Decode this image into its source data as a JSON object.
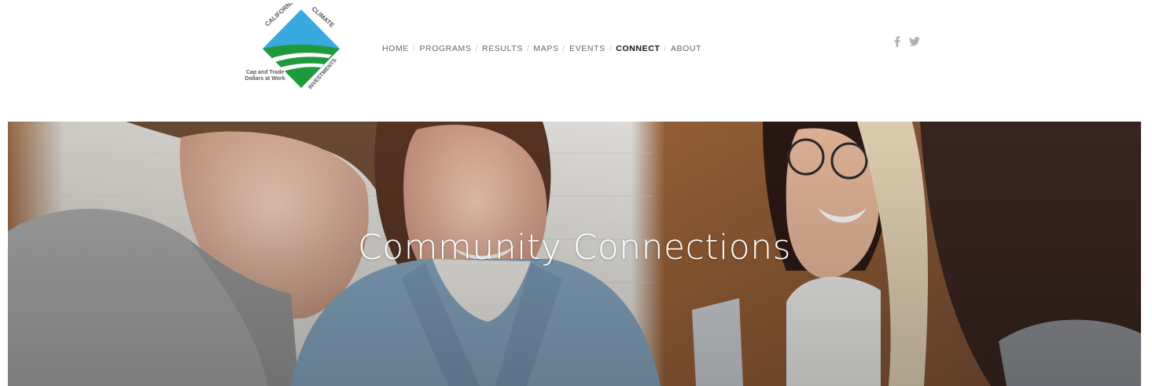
{
  "brand": {
    "logo_top_text": "CALIFORNIA",
    "logo_top_right_text": "CLIMATE",
    "logo_bottom_right_text": "INVESTMENTS",
    "tagline_line1": "Cap and Trade",
    "tagline_line2": "Dollars at Work",
    "colors": {
      "sky_blue": "#3aa9e0",
      "green": "#1e9a3c",
      "dark_green": "#0f6f2b"
    }
  },
  "nav": {
    "items": [
      {
        "label": "HOME",
        "active": false
      },
      {
        "label": "PROGRAMS",
        "active": false
      },
      {
        "label": "RESULTS",
        "active": false
      },
      {
        "label": "MAPS",
        "active": false
      },
      {
        "label": "EVENTS",
        "active": false
      },
      {
        "label": "CONNECT",
        "active": true
      },
      {
        "label": "ABOUT",
        "active": false
      }
    ],
    "separator": "/"
  },
  "social": {
    "icons": [
      "facebook-icon",
      "twitter-icon"
    ],
    "icon_color": "#b0b0b0"
  },
  "hero": {
    "title": "Community Connections"
  }
}
